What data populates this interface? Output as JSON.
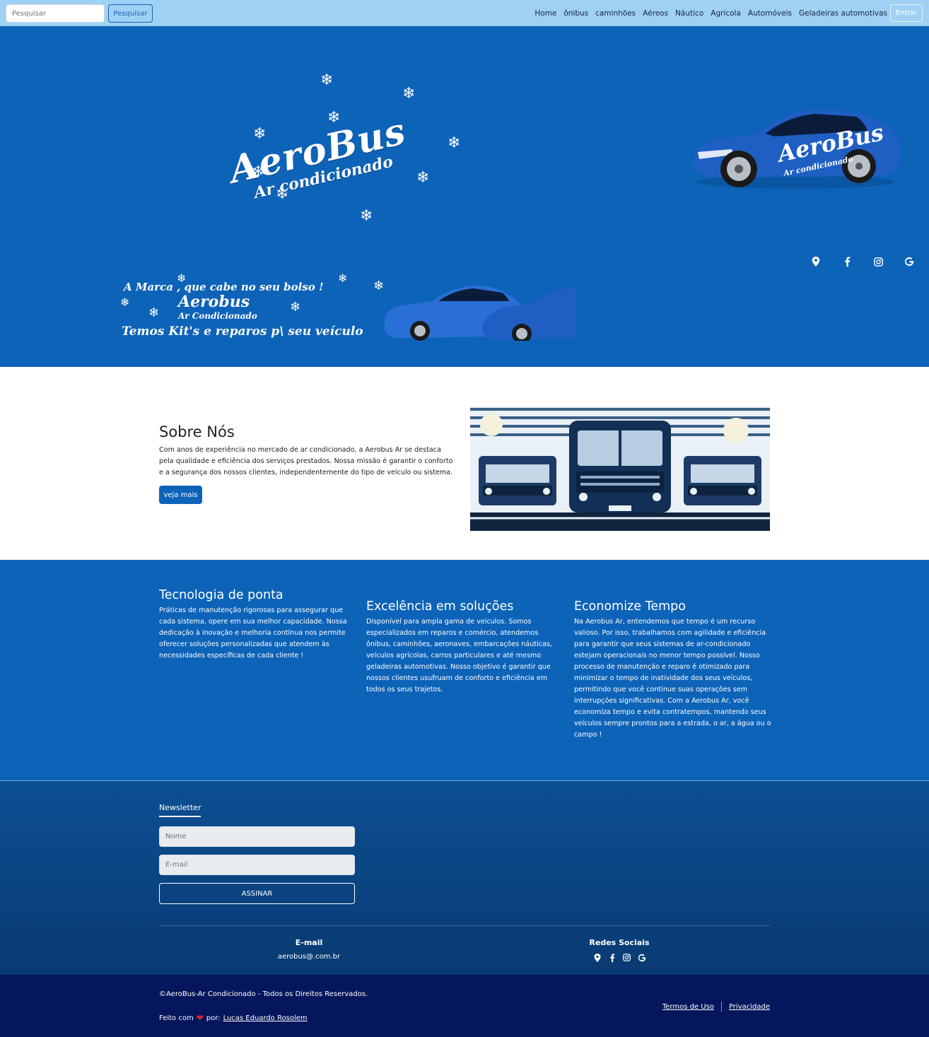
{
  "navbar": {
    "search_placeholder": "Pesquisar",
    "search_button": "Pesquisar",
    "links": [
      "Home",
      "ônibus",
      "caminhões",
      "Aéreos",
      "Náutico",
      "Agrícola",
      "Automóveis",
      "Geladeiras automotivas"
    ],
    "login_button": "Entrar"
  },
  "hero": {
    "logo_brand": "AeroBus",
    "logo_sub": "Ar condicionado",
    "car_brand": "AeroBus",
    "car_sub": "Ar condicionado",
    "social_icons": [
      "map-pin-icon",
      "facebook-icon",
      "instagram-icon",
      "google-icon"
    ],
    "promo": {
      "tagline": "A Marca , que cabe no seu bolso !",
      "brand": "Aerobus",
      "sub": "Ar Condicionado",
      "kits": "Temos Kit's e reparos p\\ seu veículo"
    }
  },
  "about": {
    "title": "Sobre Nós",
    "text": "Com anos de experiência no mercado de ar condicionado, a Aerobus Ar se destaca pela qualidade e eficiência dos serviços prestados. Nossa missão é garantir o conforto e a segurança dos nossos clientes, independentemente do tipo de veículo ou sistema.",
    "button": "veja mais"
  },
  "features": [
    {
      "title": "Tecnologia de ponta",
      "text": "Práticas de manutenção rigorosas para assegurar que cada sistema, opere em sua melhor capacidade. Nossa dedicação à inovação e melhoria contínua nos permite oferecer soluções personalizadas que atendem às necessidades específicas de cada cliente !"
    },
    {
      "title": "Excelência em soluções",
      "text": "Disponível para ampla gama de veículos. Somos especializados em reparos e comércio, atendemos ônibus, caminhões, aeronaves, embarcações náuticas, veículos agrícolas, carros particulares e até mesmo geladeiras automotivas. Nosso objetivo é garantir que nossos clientes usufruam de conforto e eficiência em todos os seus trajetos."
    },
    {
      "title": "Economize Tempo",
      "text": "Na Aerobus Ar, entendemos que tempo é um recurso valioso. Por isso, trabalhamos com agilidade e eficiência para garantir que seus sistemas de ar-condicionado estejam operacionais no menor tempo possível. Nosso processo de manutenção e reparo é otimizado para minimizar o tempo de inatividade dos seus veículos, permitindo que você continue suas operações sem interrupções significativas. Com a Aerobus Ar, você economiza tempo e evita contratempos, mantendo seus veículos sempre prontos para a estrada, o ar, a água ou o campo !"
    }
  ],
  "newsletter": {
    "title": "Newsletter",
    "name_placeholder": "Nome",
    "email_placeholder": "E-mail",
    "button": "ASSINAR"
  },
  "contact": {
    "email_title": "E-mail",
    "email_value": "aerobus@.com.br",
    "social_title": "Redes Sociais"
  },
  "bottom": {
    "copyright": "©AeroBus-Ar Condicionado - Todos os Direitos Reservados.",
    "made_prefix": "Feito com",
    "made_by": "por:",
    "author": "Lucas Eduardo Rosolem",
    "terms": "Termos de Uso",
    "privacy": "Privacidade"
  },
  "colors": {
    "navbar": "#9fd1f5",
    "hero": "#0d63b8",
    "footer": "#0a3a72",
    "bottom": "#06165c",
    "heart": "#e3262f"
  }
}
